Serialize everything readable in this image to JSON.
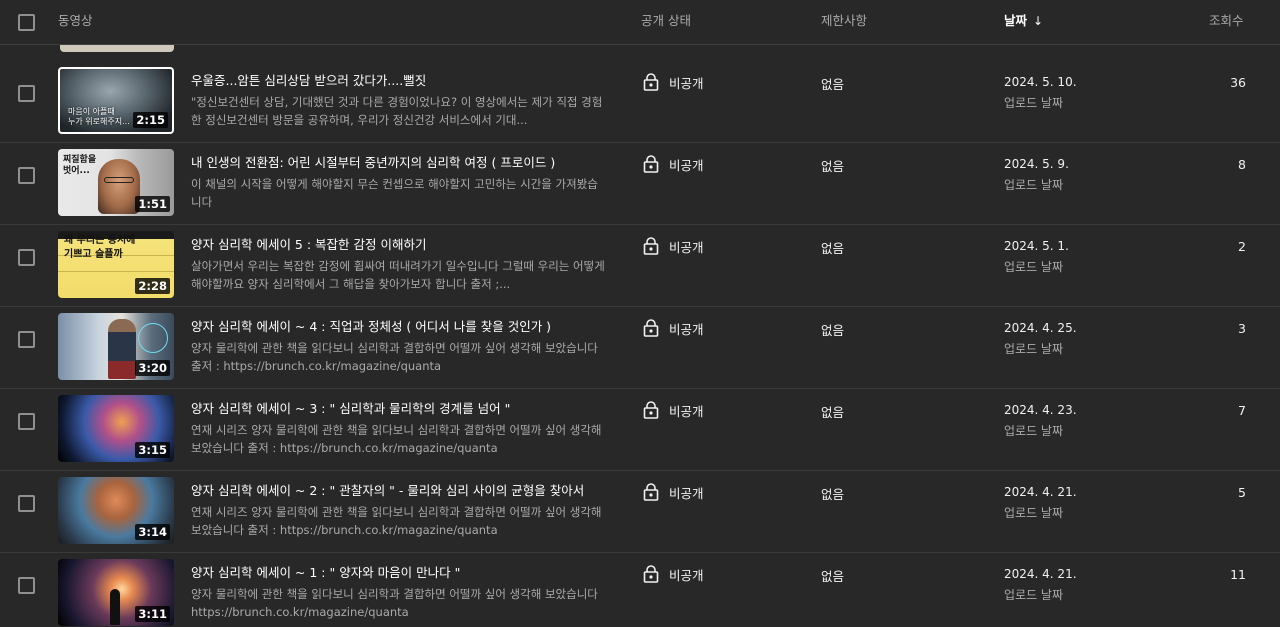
{
  "header": {
    "video_col": "동영상",
    "visibility_col": "공개 상태",
    "restrictions_col": "제한사항",
    "date_col": "날짜",
    "sort_arrow": "↓",
    "views_col": "조회수"
  },
  "colors": {
    "background": "#282828",
    "divider": "#3f3f3f",
    "text_primary": "#f1f1f1",
    "text_secondary": "#aaaaaa"
  },
  "videos": [
    {
      "title": "우울증...암튼 심리상담 받으러 갔다가....뻘짓",
      "description": "\"정신보건센터 상담, 기대했던 것과 다른 경험이었나요? 이 영상에서는 제가 직접 경험한 정신보건센터 방문을 공유하며, 우리가 정신건강 서비스에서 기대...",
      "duration": "2:15",
      "thumb_text": "마음이 아플때\n누가 위로해주지...",
      "visibility": "비공개",
      "restriction": "없음",
      "date": "2024. 5. 10.",
      "date_type": "업로드 날짜",
      "views": "36"
    },
    {
      "title": "내 인생의 전환점: 어린 시절부터 중년까지의 심리학 여정 ( 프로이드 )",
      "description": "이 채널의 시작을 어떻게 해야할지 무슨 컨셉으로 해야할지 고민하는 시간을 가져봤습니다",
      "duration": "1:51",
      "thumb_text": "찌질함을\n벗어...",
      "visibility": "비공개",
      "restriction": "없음",
      "date": "2024. 5. 9.",
      "date_type": "업로드 날짜",
      "views": "8"
    },
    {
      "title": "양자 심리학 에세이 5 : 복잡한 감정 이해하기",
      "description": "살아가면서 우리는 복잡한 감정에 휩싸여 떠내려가기 일수입니다 그럴때 우리는 어떻게 해야할까요 양자 심리학에서 그 해답을 찾아가보자 합니다 출저 ;...",
      "duration": "2:28",
      "thumb_text": "왜 우리는 동시에\n기쁘고 슬플까",
      "visibility": "비공개",
      "restriction": "없음",
      "date": "2024. 5. 1.",
      "date_type": "업로드 날짜",
      "views": "2"
    },
    {
      "title": "양자 심리학 에세이 ~ 4 : 직업과 정체성 ( 어디서 나를 찾을 것인가 )",
      "description": "양자 물리학에 관한 책을 읽다보니 심리학과 결합하면 어떨까 싶어 생각해 보았습니다 출저 : https://brunch.co.kr/magazine/quanta",
      "duration": "3:20",
      "thumb_text": "",
      "visibility": "비공개",
      "restriction": "없음",
      "date": "2024. 4. 25.",
      "date_type": "업로드 날짜",
      "views": "3"
    },
    {
      "title": "양자 심리학 에세이 ~ 3 : \" 심리학과 물리학의 경계를 넘어 \"",
      "description": "연재 시리즈 양자 물리학에 관한 책을 읽다보니 심리학과 결합하면 어떨까 싶어 생각해 보았습니다 출저 : https://brunch.co.kr/magazine/quanta",
      "duration": "3:15",
      "thumb_text": "",
      "visibility": "비공개",
      "restriction": "없음",
      "date": "2024. 4. 23.",
      "date_type": "업로드 날짜",
      "views": "7"
    },
    {
      "title": "양자 심리학 에세이 ~ 2 : \" 관찰자의 \" - 물리와 심리 사이의 균형을 찾아서",
      "description": "연재 시리즈 양자 물리학에 관한 책을 읽다보니 심리학과 결합하면 어떨까 싶어 생각해 보았습니다 출저 : https://brunch.co.kr/magazine/quanta",
      "duration": "3:14",
      "thumb_text": "",
      "visibility": "비공개",
      "restriction": "없음",
      "date": "2024. 4. 21.",
      "date_type": "업로드 날짜",
      "views": "5"
    },
    {
      "title": "양자 심리학 에세이 ~ 1 : \" 양자와 마음이 만나다 \"",
      "description": "양자 물리학에 관한 책을 읽다보니 심리학과 결합하면 어떨까 싶어 생각해 보았습니다 https://brunch.co.kr/magazine/quanta",
      "duration": "3:11",
      "thumb_text": "",
      "visibility": "비공개",
      "restriction": "없음",
      "date": "2024. 4. 21.",
      "date_type": "업로드 날짜",
      "views": "11"
    }
  ]
}
